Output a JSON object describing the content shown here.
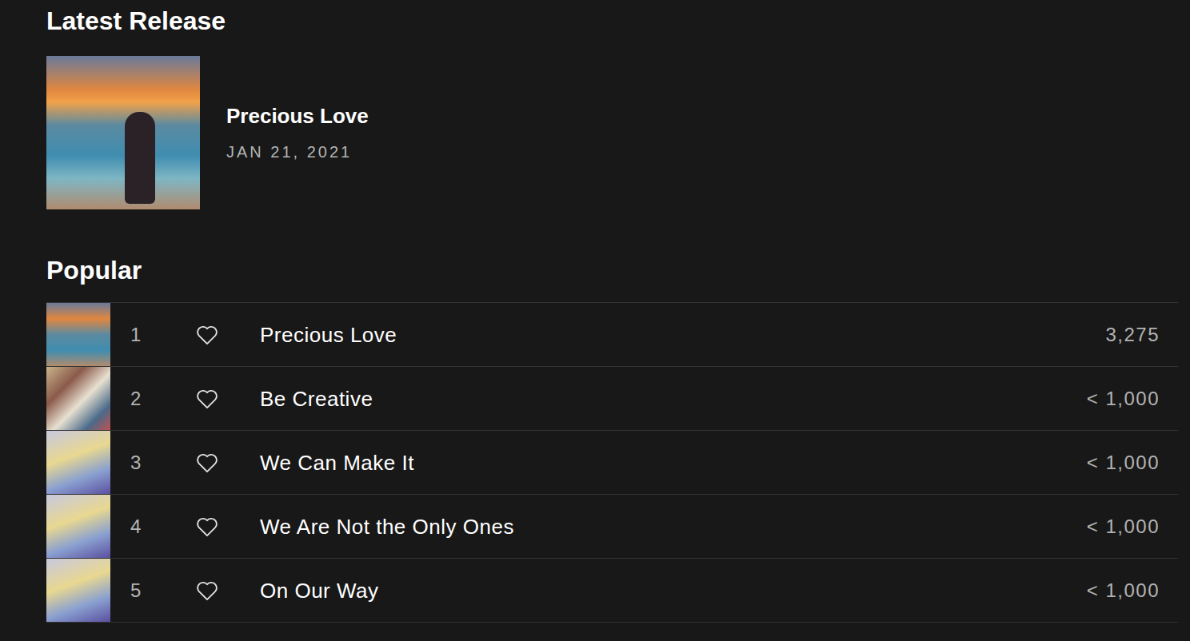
{
  "latest_release": {
    "heading": "Latest Release",
    "title": "Precious Love",
    "date": "JAN 21, 2021"
  },
  "popular": {
    "heading": "Popular",
    "tracks": [
      {
        "rank": "1",
        "title": "Precious Love",
        "plays": "3,275",
        "liked": false
      },
      {
        "rank": "2",
        "title": "Be Creative",
        "plays": "< 1,000",
        "liked": false
      },
      {
        "rank": "3",
        "title": "We Can Make It",
        "plays": "< 1,000",
        "liked": false
      },
      {
        "rank": "4",
        "title": "We Are Not the Only Ones",
        "plays": "< 1,000",
        "liked": false
      },
      {
        "rank": "5",
        "title": "On Our Way",
        "plays": "< 1,000",
        "liked": false
      }
    ]
  }
}
